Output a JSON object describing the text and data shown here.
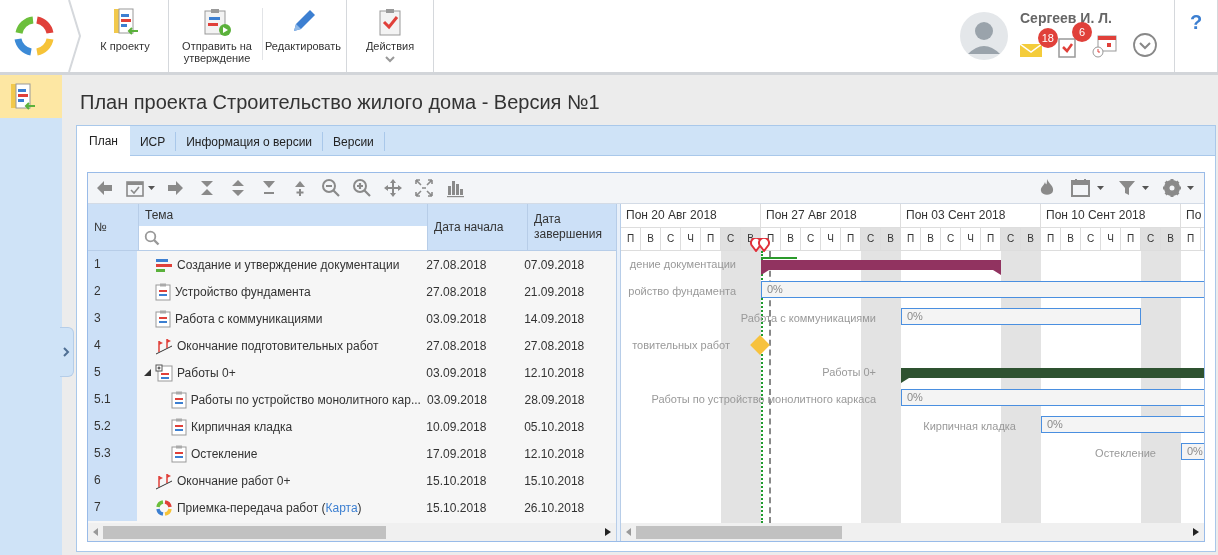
{
  "toolbar": {
    "buttons": [
      {
        "label": "К проекту",
        "kind": "project",
        "dropdown": false
      },
      {
        "label": "Отправить на утверждение",
        "kind": "send",
        "dropdown": false
      },
      {
        "label": "Редактировать",
        "kind": "edit",
        "dropdown": false
      },
      {
        "label": "Действия",
        "kind": "actions",
        "dropdown": true
      }
    ]
  },
  "user": {
    "name": "Сергеев И. Л.",
    "mail_count": "18",
    "task_count": "6"
  },
  "help": "?",
  "page_title": "План проекта Строительство жилого дома - Версия №1",
  "tabs": [
    {
      "label": "План",
      "selected": true
    },
    {
      "label": "ИСР",
      "selected": false
    },
    {
      "label": "Информация о версии",
      "selected": false
    },
    {
      "label": "Версии",
      "selected": false
    }
  ],
  "grid": {
    "columns": [
      "№",
      "Тема",
      "Дата начала",
      "Дата завершения"
    ],
    "rows": [
      {
        "number": "1",
        "kind": "summary",
        "title": "Создание и утверждение документации",
        "start": "27.08.2018",
        "end": "07.09.2018",
        "bar": {
          "kind": "summary",
          "color": "#913360",
          "label": "дение документации"
        }
      },
      {
        "number": "2",
        "kind": "task",
        "title": "Устройство фундамента",
        "start": "27.08.2018",
        "end": "21.09.2018",
        "bar": {
          "kind": "task",
          "progress_label": "0%",
          "label": "ройство фундамента"
        }
      },
      {
        "number": "3",
        "kind": "task",
        "title": "Работа с коммуникациями",
        "start": "03.09.2018",
        "end": "14.09.2018",
        "bar": {
          "kind": "task",
          "progress_label": "0%",
          "label": "Работа с коммуникациями"
        }
      },
      {
        "number": "4",
        "kind": "milestone",
        "title": "Окончание подготовительных работ",
        "start": "27.08.2018",
        "end": "27.08.2018",
        "bar": {
          "kind": "milestone",
          "label": "товительных работ"
        }
      },
      {
        "number": "5",
        "kind": "group",
        "title": "Работы 0+",
        "start": "03.09.2018",
        "end": "12.10.2018",
        "bar": {
          "kind": "summary",
          "color": "#2e5230",
          "label": "Работы 0+"
        },
        "expanded": true,
        "children": [
          {
            "number": "5.1",
            "kind": "task",
            "title": "Работы по устройство монолитного кар...",
            "start": "03.09.2018",
            "end": "28.09.2018",
            "bar": {
              "kind": "task",
              "progress_label": "0%",
              "label": "Работы по устройство монолитного каркаса"
            }
          },
          {
            "number": "5.2",
            "kind": "task",
            "title": "Кирпичная кладка",
            "start": "10.09.2018",
            "end": "05.10.2018",
            "bar": {
              "kind": "task",
              "progress_label": "0%",
              "label": "Кирпичная кладка"
            }
          },
          {
            "number": "5.3",
            "kind": "task",
            "title": "Остекление",
            "start": "17.09.2018",
            "end": "12.10.2018",
            "bar": {
              "kind": "task",
              "progress_label": "0%",
              "label": "Остекление"
            }
          }
        ]
      },
      {
        "number": "6",
        "kind": "milestone",
        "title": "Окончание работ 0+",
        "start": "15.10.2018",
        "end": "15.10.2018"
      },
      {
        "number": "7",
        "kind": "process",
        "title": "Приемка-передача работ (",
        "link": "Карта",
        "title_end": ")",
        "start": "15.10.2018",
        "end": "26.10.2018"
      }
    ]
  },
  "timeline": {
    "weeks": [
      "Пон 20 Авг 2018",
      "Пон 27 Авг 2018",
      "Пон 03 Сент 2018",
      "Пон 10 Сент 2018",
      "По"
    ],
    "days": [
      {
        "letter": "П",
        "weekend": false
      },
      {
        "letter": "В",
        "weekend": false
      },
      {
        "letter": "С",
        "weekend": false
      },
      {
        "letter": "Ч",
        "weekend": false
      },
      {
        "letter": "П",
        "weekend": false
      },
      {
        "letter": "С",
        "weekend": true
      },
      {
        "letter": "В",
        "weekend": true
      },
      {
        "letter": "П",
        "weekend": false
      },
      {
        "letter": "В",
        "weekend": false
      },
      {
        "letter": "С",
        "weekend": false
      },
      {
        "letter": "Ч",
        "weekend": false
      },
      {
        "letter": "П",
        "weekend": false
      },
      {
        "letter": "С",
        "weekend": true
      },
      {
        "letter": "В",
        "weekend": true
      },
      {
        "letter": "П",
        "weekend": false
      },
      {
        "letter": "В",
        "weekend": false
      },
      {
        "letter": "С",
        "weekend": false
      },
      {
        "letter": "Ч",
        "weekend": false
      },
      {
        "letter": "П",
        "weekend": false
      },
      {
        "letter": "С",
        "weekend": true
      },
      {
        "letter": "В",
        "weekend": true
      },
      {
        "letter": "П",
        "weekend": false
      },
      {
        "letter": "В",
        "weekend": false
      },
      {
        "letter": "С",
        "weekend": false
      },
      {
        "letter": "Ч",
        "weekend": false
      },
      {
        "letter": "П",
        "weekend": false
      },
      {
        "letter": "С",
        "weekend": true
      },
      {
        "letter": "В",
        "weekend": true
      },
      {
        "letter": "П",
        "weekend": false
      }
    ]
  }
}
